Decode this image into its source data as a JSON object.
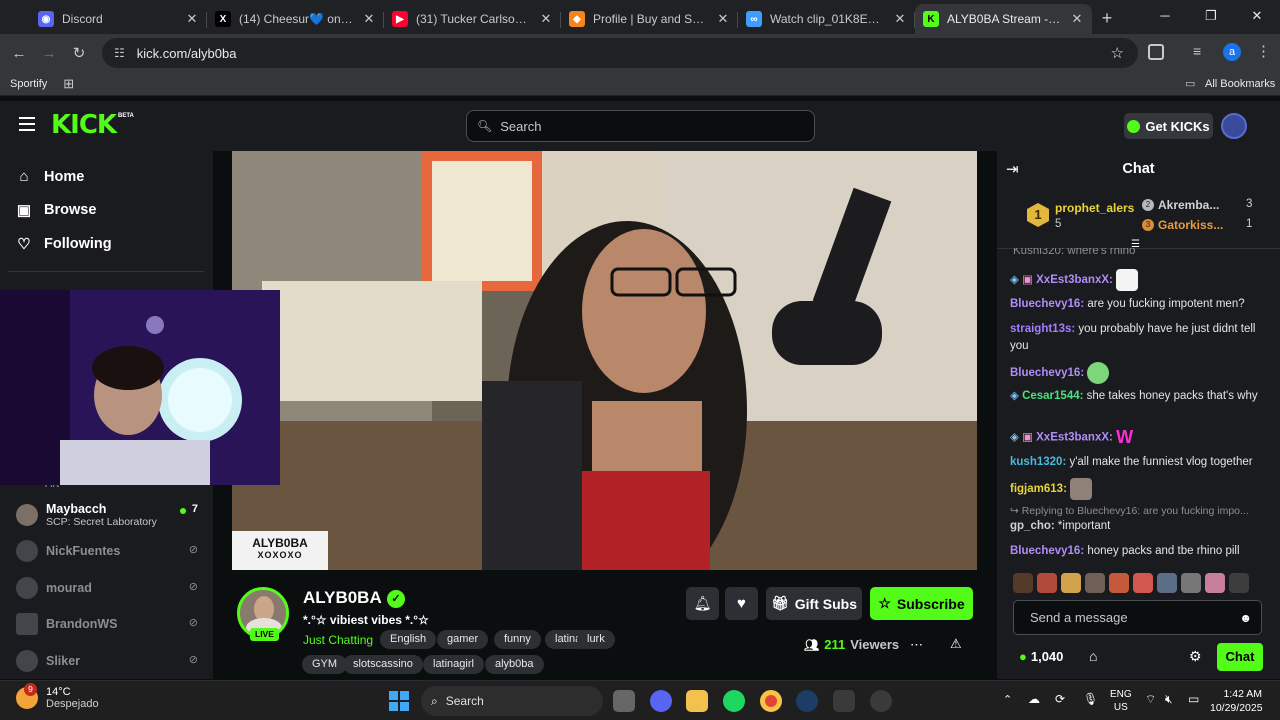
{
  "browser": {
    "tabs": [
      {
        "label": "Discord",
        "icon": "discord-icon",
        "color": "#5865f2"
      },
      {
        "label": "(14) Cheesur💙 on X: \"@f",
        "icon": "x-icon",
        "color": "#000000"
      },
      {
        "label": "(31) Tucker Carlson Intervie",
        "icon": "youtube-icon",
        "color": "#ff0033"
      },
      {
        "label": "Profile | Buy and Sell Skins",
        "icon": "fox-icon",
        "color": "#f6851b"
      },
      {
        "label": "Watch clip_01K8EVTG2XK8",
        "icon": "link-icon",
        "color": "#3d9eff"
      },
      {
        "label": "ALYB0BA Stream - Watch L",
        "icon": "kick-icon",
        "color": "#53fc18"
      }
    ],
    "url": "kick.com/alyb0ba",
    "bookmarks": {
      "left": "Sportify",
      "right": "All Bookmarks"
    },
    "profile_initial": "a"
  },
  "kick": {
    "logo": "KICK",
    "logo_badge": "BETA",
    "search_placeholder": "Search",
    "get_kicks": "Get KICKs",
    "accent": "#53fc18"
  },
  "sidebar": {
    "nav": [
      {
        "label": "Home",
        "icon": "home-icon"
      },
      {
        "label": "Browse",
        "icon": "browse-icon"
      },
      {
        "label": "Following",
        "icon": "heart-icon"
      }
    ],
    "partial_label": "Art",
    "channels": [
      {
        "name": "Maybacch",
        "game": "SCP: Secret Laboratory",
        "viewers": "7",
        "live": true
      },
      {
        "name": "NickFuentes",
        "live": false
      },
      {
        "name": "mourad",
        "live": false
      },
      {
        "name": "BrandonWS",
        "live": false
      },
      {
        "name": "Sliker",
        "live": false
      }
    ]
  },
  "player": {
    "overlay_logo_top": "ALYB0BA",
    "overlay_logo_bottom": "XOXOXO"
  },
  "stream": {
    "streamer": "ALYB0BA",
    "live_badge": "LIVE",
    "title": "*.°☆ vibiest vibes *.°☆",
    "category": "Just Chatting",
    "tags_row1": [
      "English",
      "gamer",
      "funny",
      "latina",
      "lurk"
    ],
    "tags_row2": [
      "GYM",
      "slotscassino",
      "latinagirl",
      "alyb0ba"
    ],
    "gift_subs": "Gift Subs",
    "subscribe": "Subscribe",
    "viewers_count": "211",
    "viewers_label": "Viewers"
  },
  "chat": {
    "title": "Chat",
    "leaderboard": {
      "first": {
        "rank": "1",
        "name": "prophet_alers",
        "points": "5"
      },
      "second": {
        "rank": "2",
        "name": "Akremba...",
        "points": "3"
      },
      "third": {
        "rank": "3",
        "name": "Gatorkiss...",
        "points": "1"
      }
    },
    "truncated_top": "Kushi320: where's rhino",
    "messages": [
      {
        "user": "XxEst3banxX",
        "color": "#b28cf7",
        "text": "",
        "emote": "OH BOY"
      },
      {
        "user": "Bluechevy16",
        "color": "#b28cf7",
        "text": "are you fucking impotent men?"
      },
      {
        "user": "straight13s",
        "color": "#a37eff",
        "text": "you probably have he just didnt tell you"
      },
      {
        "user": "Bluechevy16",
        "color": "#b28cf7",
        "text": "",
        "emote": "face"
      },
      {
        "user": "Cesar1544",
        "color": "#4be17f",
        "text": "she takes honey packs that's why"
      },
      {
        "user": "XxEst3banxX",
        "color": "#b28cf7",
        "text": "",
        "emote": "W"
      },
      {
        "user": "kush1320",
        "color": "#4bb8e1",
        "text": "y'all make the funniest vlog together"
      },
      {
        "user": "figjam613",
        "color": "#e9d33b",
        "text": "",
        "emote": "meme"
      },
      {
        "user": "gp_cho",
        "color": "#d0d2d4",
        "text": "*important",
        "reply": "Replying to Bluechevy16: are you fucking impo..."
      },
      {
        "user": "Bluechevy16",
        "color": "#b28cf7",
        "text": "honey packs and tbe rhino pill"
      }
    ],
    "input_placeholder": "Send a message",
    "kicks_balance": "1,040",
    "send_button": "Chat"
  },
  "taskbar": {
    "weather_temp": "14°C",
    "weather_desc": "Despejado",
    "weather_badge": "9",
    "search_label": "Search",
    "lang_top": "ENG",
    "lang_bottom": "US",
    "time": "1:42 AM",
    "date": "10/29/2025"
  }
}
